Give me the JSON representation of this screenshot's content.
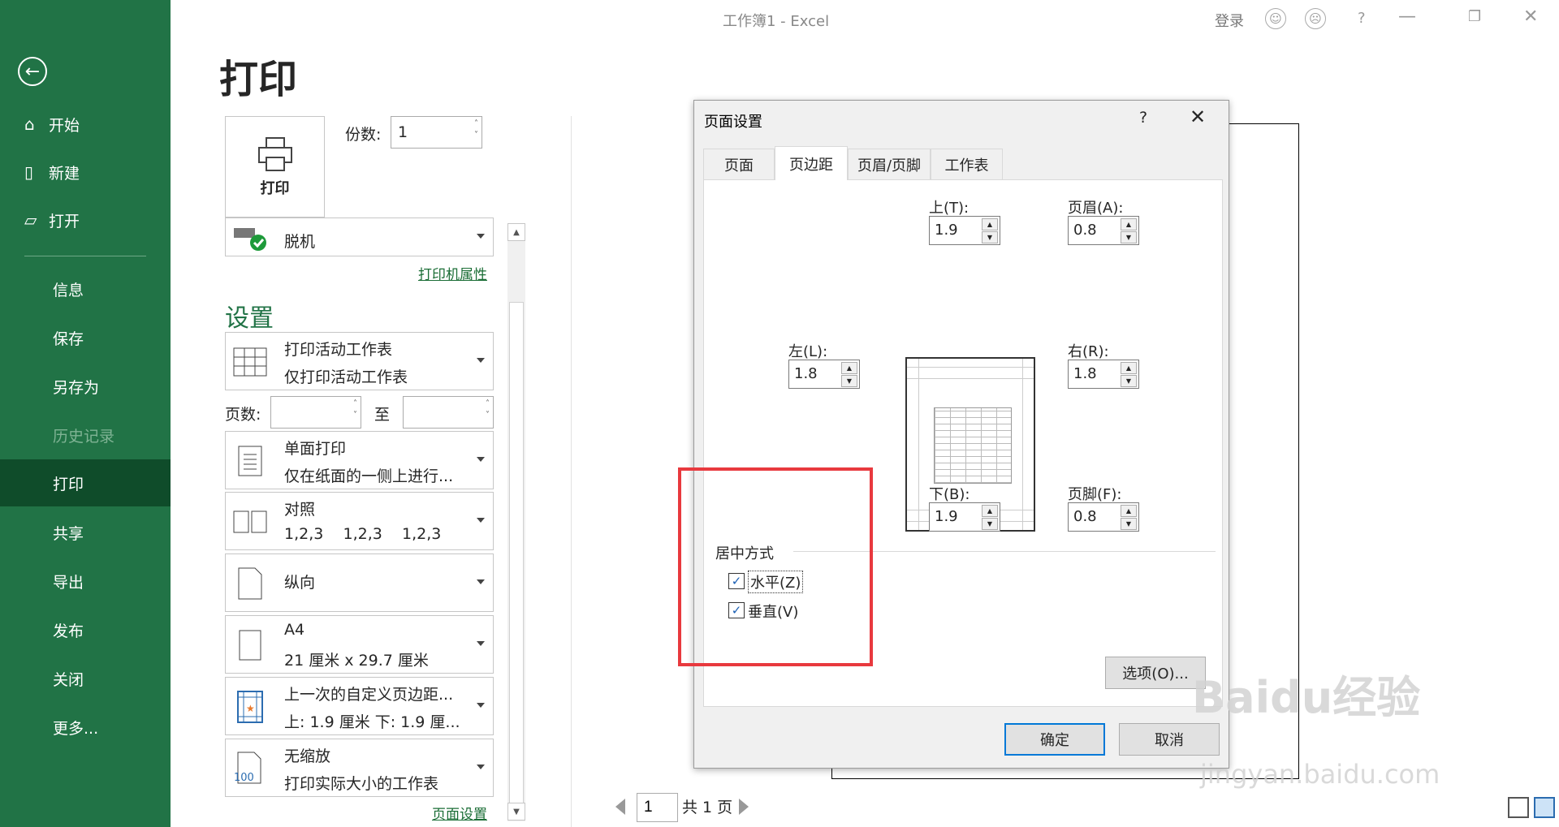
{
  "window": {
    "title": "工作簿1 -  Excel",
    "login": "登录"
  },
  "sidebar": {
    "items": [
      {
        "label": "开始"
      },
      {
        "label": "新建"
      },
      {
        "label": "打开"
      },
      {
        "label": "信息"
      },
      {
        "label": "保存"
      },
      {
        "label": "另存为"
      },
      {
        "label": "历史记录"
      },
      {
        "label": "打印"
      },
      {
        "label": "共享"
      },
      {
        "label": "导出"
      },
      {
        "label": "发布"
      },
      {
        "label": "关闭"
      },
      {
        "label": "更多..."
      }
    ]
  },
  "print": {
    "title": "打印",
    "button_label": "打印",
    "copies_label": "份数:",
    "copies_value": "1",
    "printer_name": "脱机",
    "printer_props_link": "打印机属性",
    "settings_title": "设置",
    "pages_label": "页数:",
    "to_label": "至",
    "page_setup_link": "页面设置",
    "settings": [
      {
        "l1": "打印活动工作表",
        "l2": "仅打印活动工作表"
      },
      {
        "l1": "单面打印",
        "l2": "仅在纸面的一侧上进行..."
      },
      {
        "l1": "对照",
        "l2": "1,2,3    1,2,3    1,2,3"
      },
      {
        "l1": "纵向",
        "l2": ""
      },
      {
        "l1": "A4",
        "l2": "21 厘米 x 29.7 厘米"
      },
      {
        "l1": "上一次的自定义页边距...",
        "l2": "上: 1.9 厘米 下: 1.9 厘..."
      },
      {
        "l1": "无缩放",
        "l2": "打印实际大小的工作表"
      }
    ],
    "scale_icon_text": "100"
  },
  "preview": {
    "current_page": "1",
    "total_pages": "共 1 页"
  },
  "dialog": {
    "title": "页面设置",
    "help": "?",
    "tabs": [
      "页面",
      "页边距",
      "页眉/页脚",
      "工作表"
    ],
    "active_tab": "页边距",
    "top_label": "上(T):",
    "top_value": "1.9",
    "header_label": "页眉(A):",
    "header_value": "0.8",
    "left_label": "左(L):",
    "left_value": "1.8",
    "right_label": "右(R):",
    "right_value": "1.8",
    "bottom_label": "下(B):",
    "bottom_value": "1.9",
    "footer_label": "页脚(F):",
    "footer_value": "0.8",
    "centering_title": "居中方式",
    "horizontal_label": "水平(Z)",
    "horizontal_checked": true,
    "vertical_label": "垂直(V)",
    "vertical_checked": true,
    "options_button": "选项(O)...",
    "ok_button": "确定",
    "cancel_button": "取消"
  },
  "watermark": {
    "brand": "Baidu经验",
    "url": "jingyan.baidu.com"
  },
  "colors": {
    "sidebar": "#217346",
    "active": "#0f4c2a",
    "highlight": "#e8393e",
    "primary_border": "#0078d7"
  }
}
